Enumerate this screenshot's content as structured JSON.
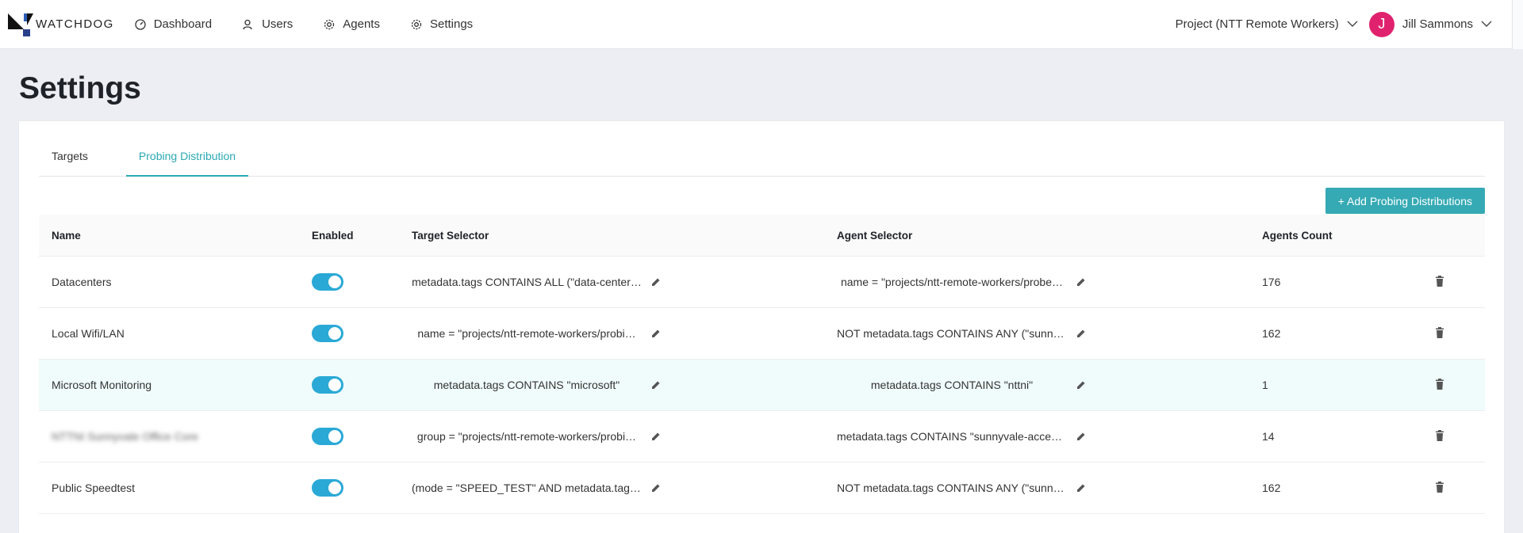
{
  "app": {
    "logo_text": "WATCHDOG"
  },
  "nav": {
    "items": [
      {
        "label": "Dashboard",
        "icon": "dashboard-icon"
      },
      {
        "label": "Users",
        "icon": "users-icon"
      },
      {
        "label": "Agents",
        "icon": "agents-gear-icon"
      },
      {
        "label": "Settings",
        "icon": "settings-gear-icon"
      }
    ],
    "project": "Project (NTT Remote Workers)",
    "user_initial": "J",
    "user_name": "Jill Sammons"
  },
  "page": {
    "title": "Settings"
  },
  "tabs": [
    {
      "label": "Targets",
      "active": false
    },
    {
      "label": "Probing Distribution",
      "active": true
    }
  ],
  "actions": {
    "add_label": "+ Add Probing Distributions"
  },
  "table": {
    "headers": {
      "name": "Name",
      "enabled": "Enabled",
      "target": "Target Selector",
      "agent": "Agent Selector",
      "count": "Agents Count"
    },
    "rows": [
      {
        "name": "Datacenters",
        "enabled": true,
        "target": "metadata.tags CONTAINS ALL (\"data-center…",
        "agent": "name = \"projects/ntt-remote-workers/probe…",
        "count": "176"
      },
      {
        "name": "Local Wifi/LAN",
        "enabled": true,
        "target": "name = \"projects/ntt-remote-workers/probi…",
        "agent": "NOT metadata.tags CONTAINS ANY (\"sunny…",
        "count": "162"
      },
      {
        "name": "Microsoft Monitoring",
        "enabled": true,
        "target": "metadata.tags CONTAINS \"microsoft\"",
        "agent": "metadata.tags CONTAINS \"nttni\"",
        "count": "1"
      },
      {
        "name": "NTTNI Sunnyvale Office Core",
        "enabled": true,
        "target": "group = \"projects/ntt-remote-workers/probi…",
        "agent": "metadata.tags CONTAINS \"sunnyvale-acces…",
        "count": "14"
      },
      {
        "name": "Public Speedtest",
        "enabled": true,
        "target": "(mode = \"SPEED_TEST\" AND metadata.tags…",
        "agent": "NOT metadata.tags CONTAINS ANY (\"sunny…",
        "count": "162"
      }
    ]
  },
  "colors": {
    "accent": "#2aa9b3",
    "button": "#35aab4",
    "toggle": "#2aa9d6",
    "avatar": "#e0226e",
    "highlight_row": "#f0fbfb"
  }
}
